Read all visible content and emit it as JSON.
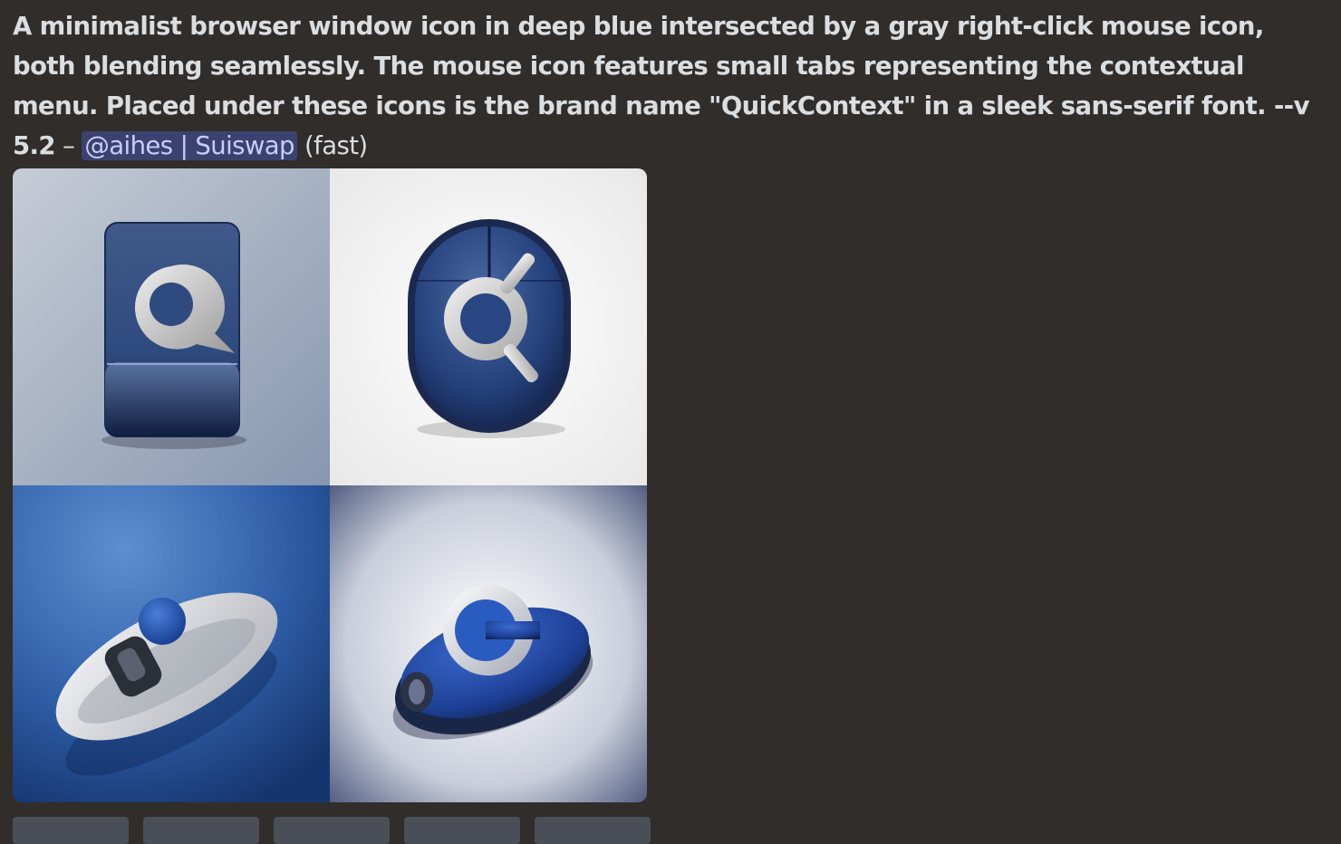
{
  "message": {
    "prompt_text": "A minimalist browser window icon in deep blue intersected by a gray right-click mouse icon, both blending seamlessly. The mouse icon features small tabs representing the contextual menu. Placed under these icons is the brand name \"QuickContext\" in a sleek sans-serif font. --v 5.2",
    "separator": "–",
    "mention": "@aihes | Suiswap",
    "speed": "(fast)"
  },
  "image_grid": {
    "tiles": [
      {
        "icon": "browser-window-q-icon"
      },
      {
        "icon": "mouse-q-icon"
      },
      {
        "icon": "silver-mouse-icon"
      },
      {
        "icon": "blue-mouse-c-icon"
      }
    ]
  },
  "colors": {
    "background": "#312d2b",
    "mention_bg": "#3c4270",
    "mention_text": "#c9cdfb",
    "deep_blue": "#1f3a73"
  }
}
